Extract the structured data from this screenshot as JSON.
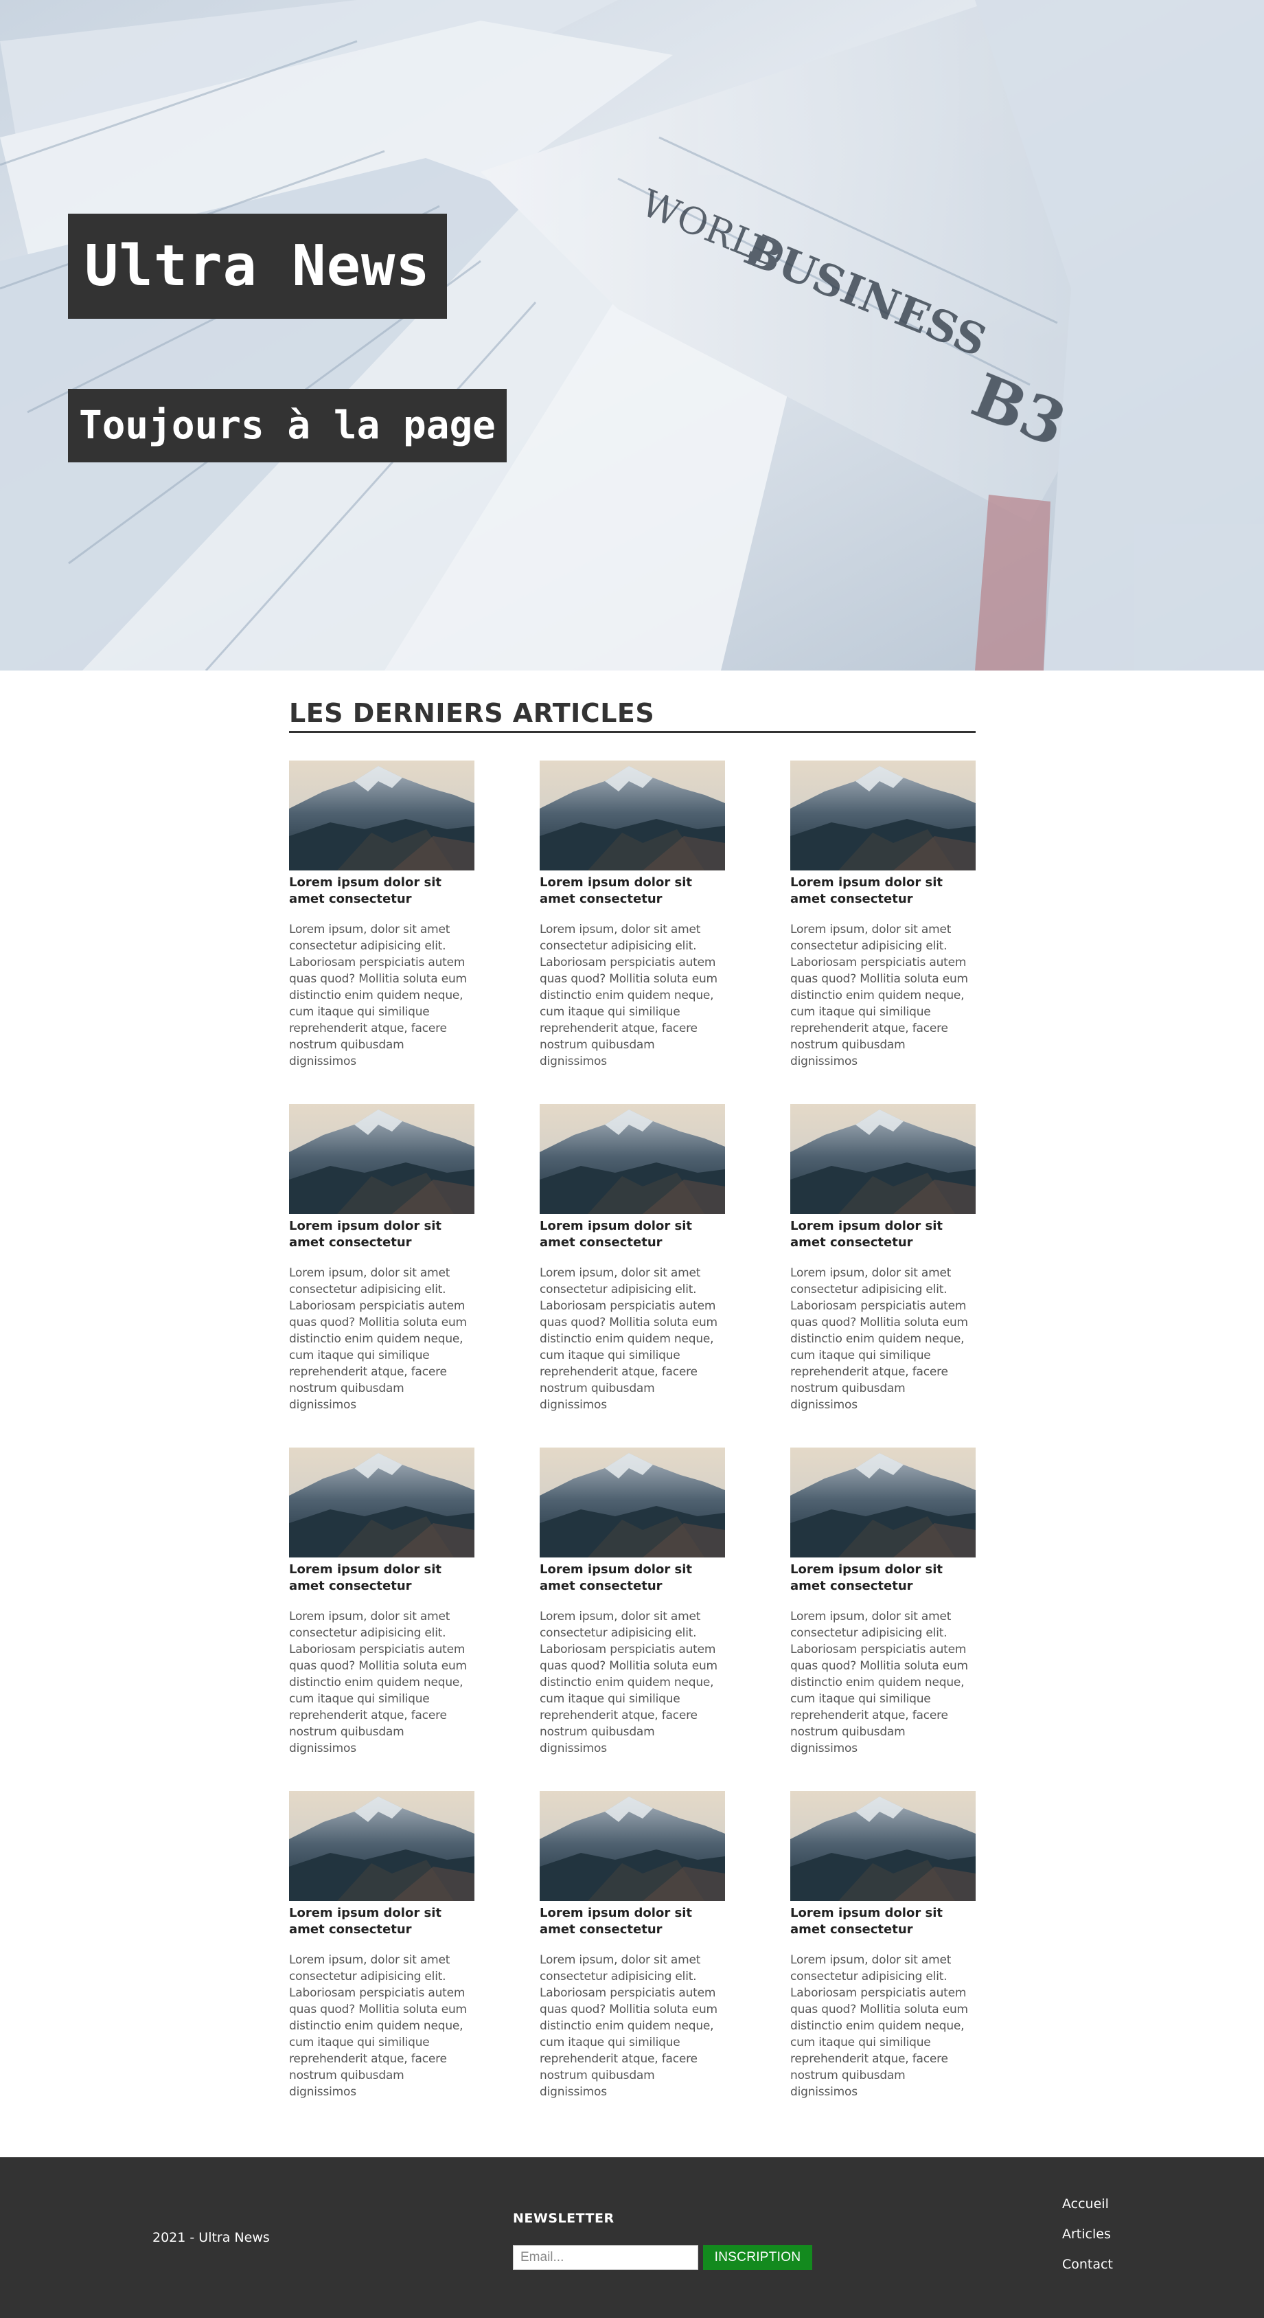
{
  "hero": {
    "title": "Ultra News",
    "subtitle": "Toujours à la page"
  },
  "main": {
    "section_title": "LES DERNIERS ARTICLES",
    "articles": [
      {
        "title": "Lorem ipsum dolor sit amet consectetur",
        "text": "Lorem ipsum, dolor sit amet consectetur adipisicing elit. Laboriosam perspiciatis autem quas quod? Mollitia soluta eum distinctio enim quidem neque, cum itaque qui similique reprehenderit atque, facere nostrum quibusdam dignissimos"
      },
      {
        "title": "Lorem ipsum dolor sit amet consectetur",
        "text": "Lorem ipsum, dolor sit amet consectetur adipisicing elit. Laboriosam perspiciatis autem quas quod? Mollitia soluta eum distinctio enim quidem neque, cum itaque qui similique reprehenderit atque, facere nostrum quibusdam dignissimos"
      },
      {
        "title": "Lorem ipsum dolor sit amet consectetur",
        "text": "Lorem ipsum, dolor sit amet consectetur adipisicing elit. Laboriosam perspiciatis autem quas quod? Mollitia soluta eum distinctio enim quidem neque, cum itaque qui similique reprehenderit atque, facere nostrum quibusdam dignissimos"
      },
      {
        "title": "Lorem ipsum dolor sit amet consectetur",
        "text": "Lorem ipsum, dolor sit amet consectetur adipisicing elit. Laboriosam perspiciatis autem quas quod? Mollitia soluta eum distinctio enim quidem neque, cum itaque qui similique reprehenderit atque, facere nostrum quibusdam dignissimos"
      },
      {
        "title": "Lorem ipsum dolor sit amet consectetur",
        "text": "Lorem ipsum, dolor sit amet consectetur adipisicing elit. Laboriosam perspiciatis autem quas quod? Mollitia soluta eum distinctio enim quidem neque, cum itaque qui similique reprehenderit atque, facere nostrum quibusdam dignissimos"
      },
      {
        "title": "Lorem ipsum dolor sit amet consectetur",
        "text": "Lorem ipsum, dolor sit amet consectetur adipisicing elit. Laboriosam perspiciatis autem quas quod? Mollitia soluta eum distinctio enim quidem neque, cum itaque qui similique reprehenderit atque, facere nostrum quibusdam dignissimos"
      },
      {
        "title": "Lorem ipsum dolor sit amet consectetur",
        "text": "Lorem ipsum, dolor sit amet consectetur adipisicing elit. Laboriosam perspiciatis autem quas quod? Mollitia soluta eum distinctio enim quidem neque, cum itaque qui similique reprehenderit atque, facere nostrum quibusdam dignissimos"
      },
      {
        "title": "Lorem ipsum dolor sit amet consectetur",
        "text": "Lorem ipsum, dolor sit amet consectetur adipisicing elit. Laboriosam perspiciatis autem quas quod? Mollitia soluta eum distinctio enim quidem neque, cum itaque qui similique reprehenderit atque, facere nostrum quibusdam dignissimos"
      },
      {
        "title": "Lorem ipsum dolor sit amet consectetur",
        "text": "Lorem ipsum, dolor sit amet consectetur adipisicing elit. Laboriosam perspiciatis autem quas quod? Mollitia soluta eum distinctio enim quidem neque, cum itaque qui similique reprehenderit atque, facere nostrum quibusdam dignissimos"
      },
      {
        "title": "Lorem ipsum dolor sit amet consectetur",
        "text": "Lorem ipsum, dolor sit amet consectetur adipisicing elit. Laboriosam perspiciatis autem quas quod? Mollitia soluta eum distinctio enim quidem neque, cum itaque qui similique reprehenderit atque, facere nostrum quibusdam dignissimos"
      },
      {
        "title": "Lorem ipsum dolor sit amet consectetur",
        "text": "Lorem ipsum, dolor sit amet consectetur adipisicing elit. Laboriosam perspiciatis autem quas quod? Mollitia soluta eum distinctio enim quidem neque, cum itaque qui similique reprehenderit atque, facere nostrum quibusdam dignissimos"
      },
      {
        "title": "Lorem ipsum dolor sit amet consectetur",
        "text": "Lorem ipsum, dolor sit amet consectetur adipisicing elit. Laboriosam perspiciatis autem quas quod? Mollitia soluta eum distinctio enim quidem neque, cum itaque qui similique reprehenderit atque, facere nostrum quibusdam dignissimos"
      }
    ]
  },
  "footer": {
    "copyright": "2021 - Ultra News",
    "newsletter_title": "NEWSLETTER",
    "email_placeholder": "Email...",
    "email_value": "",
    "subscribe_label": "INSCRIPTION",
    "subscribe_color": "#138a1e",
    "nav": [
      "Accueil",
      "Articles",
      "Contact"
    ]
  },
  "colors": {
    "dark": "#333333",
    "background": "#ffffff"
  }
}
